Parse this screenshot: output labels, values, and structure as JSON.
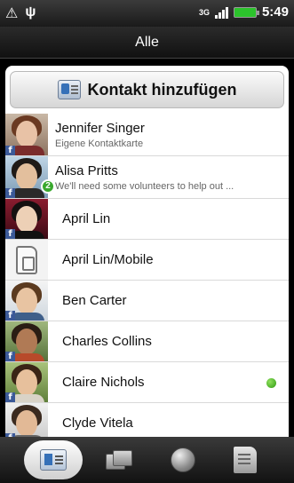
{
  "statusbar": {
    "network": "3G",
    "time": "5:49"
  },
  "titlebar": {
    "title": "Alle"
  },
  "add_contact": {
    "label": "Kontakt hinzufügen"
  },
  "contacts": [
    {
      "name": "Jennifer Singer",
      "sub": "Eigene Kontaktkarte"
    },
    {
      "name": "Alisa Pritts",
      "sub": "We'll need some volunteers to help out ...",
      "badge": "2"
    },
    {
      "name": "April Lin"
    },
    {
      "name": "April Lin/Mobile"
    },
    {
      "name": "Ben Carter"
    },
    {
      "name": "Charles Collins"
    },
    {
      "name": "Claire Nichols",
      "status": "online"
    },
    {
      "name": "Clyde Vitela"
    }
  ],
  "colors": {
    "facebook": "#3b5998",
    "online": "#39a82d",
    "notification_badge": "#39a82d"
  },
  "tabs": [
    {
      "icon": "contacts-card-icon",
      "active": true
    },
    {
      "icon": "groups-icon",
      "active": false
    },
    {
      "icon": "online-directory-globe-icon",
      "active": false
    },
    {
      "icon": "call-history-icon",
      "active": false
    }
  ]
}
